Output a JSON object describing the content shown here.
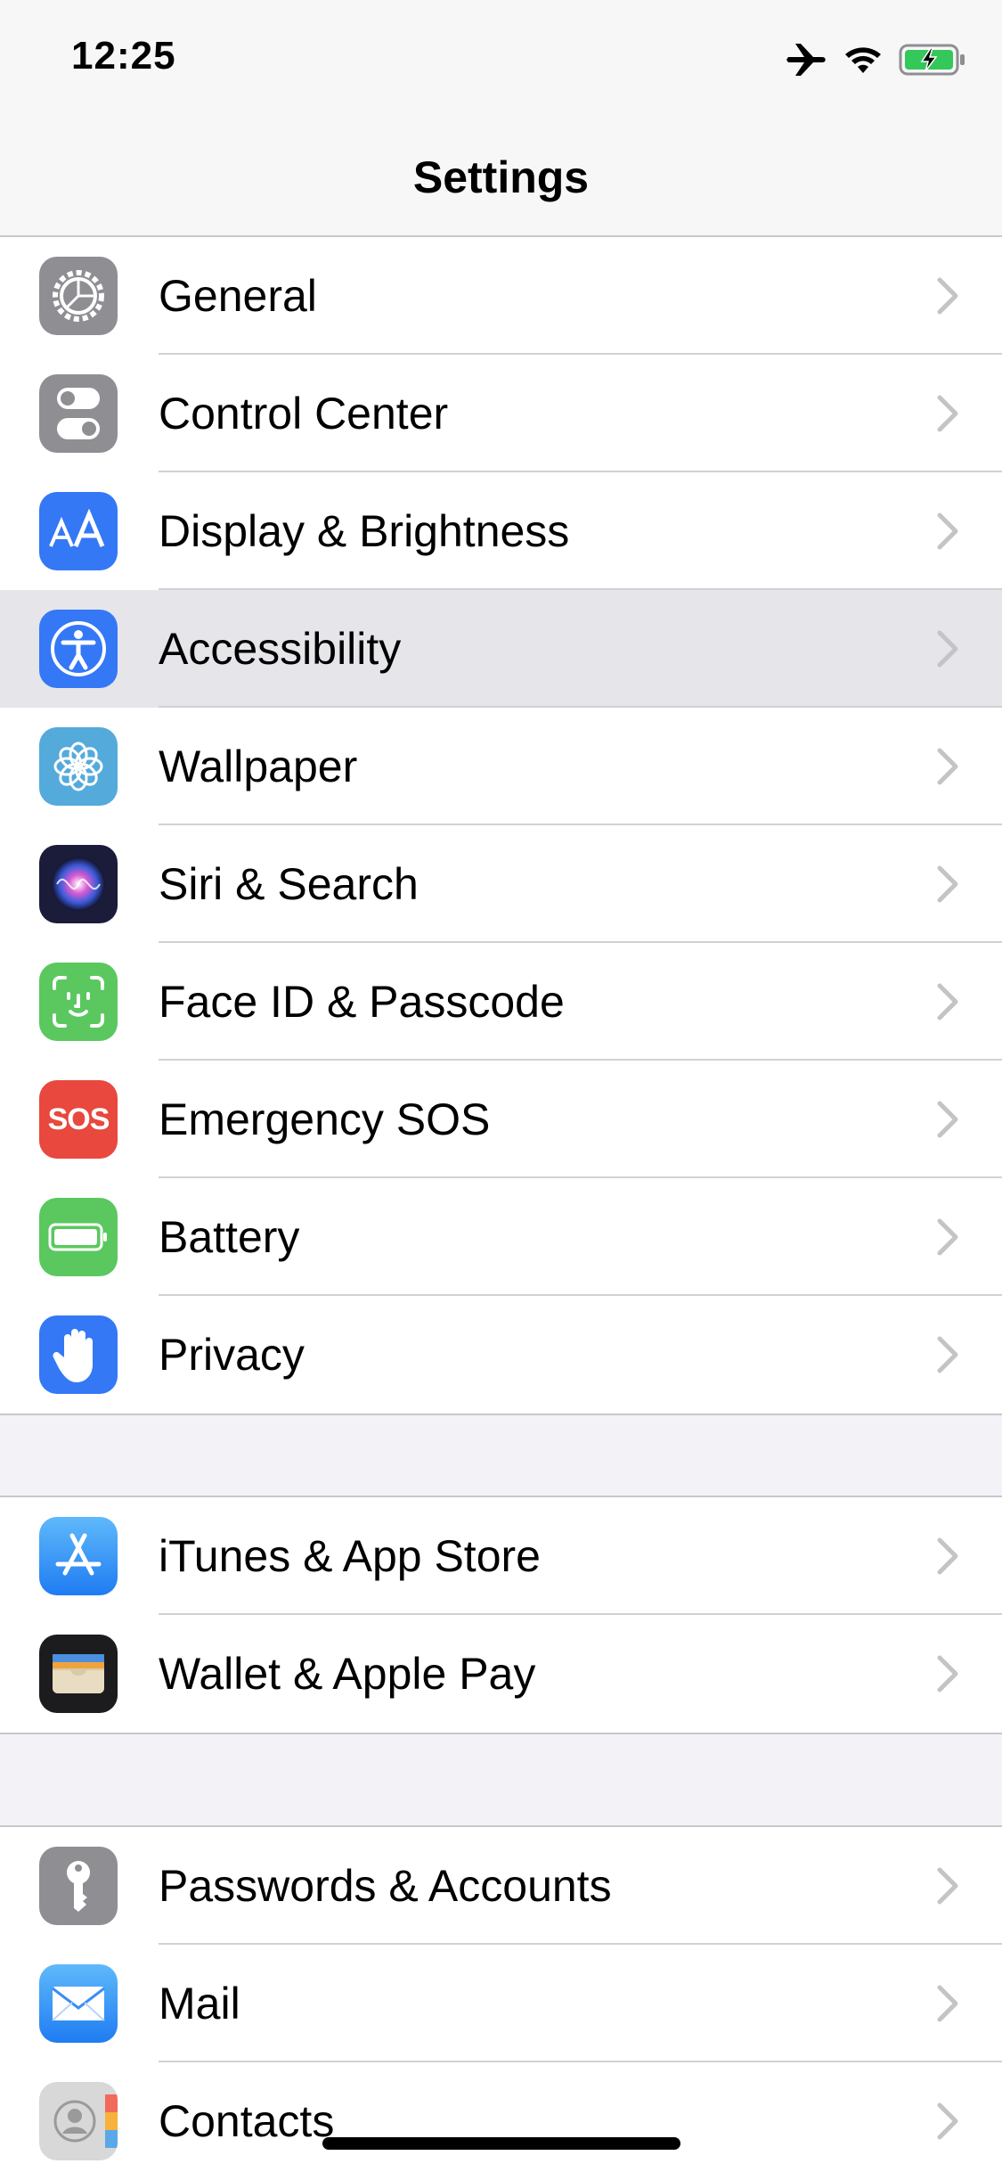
{
  "status": {
    "time": "12:25"
  },
  "nav": {
    "title": "Settings"
  },
  "colors": {
    "background": "#f2f2f7",
    "highlight": "#e5e5ea",
    "chevron": "#c4c4c7"
  },
  "groups": [
    {
      "items": [
        {
          "label": "General",
          "icon": "gear-icon",
          "color": "#8e8e93"
        },
        {
          "label": "Control Center",
          "icon": "toggles-icon",
          "color": "#8e8e93"
        },
        {
          "label": "Display & Brightness",
          "icon": "text-size-icon",
          "color": "#3478f6"
        },
        {
          "label": "Accessibility",
          "icon": "accessibility-icon",
          "color": "#3478f6",
          "highlighted": true
        },
        {
          "label": "Wallpaper",
          "icon": "flower-icon",
          "color": "#54aadb"
        },
        {
          "label": "Siri & Search",
          "icon": "siri-icon",
          "color": "#1b1b3a"
        },
        {
          "label": "Face ID & Passcode",
          "icon": "face-id-icon",
          "color": "#5ac85f"
        },
        {
          "label": "Emergency SOS",
          "icon": "sos-icon",
          "color": "#e8483d"
        },
        {
          "label": "Battery",
          "icon": "battery-icon",
          "color": "#5ac85f"
        },
        {
          "label": "Privacy",
          "icon": "hand-icon",
          "color": "#3478f6"
        }
      ]
    },
    {
      "items": [
        {
          "label": "iTunes & App Store",
          "icon": "app-store-icon",
          "color": "#3e9cf6"
        },
        {
          "label": "Wallet & Apple Pay",
          "icon": "wallet-icon",
          "color": "#1c1c1e"
        }
      ]
    },
    {
      "items": [
        {
          "label": "Passwords & Accounts",
          "icon": "key-icon",
          "color": "#8e8e93"
        },
        {
          "label": "Mail",
          "icon": "mail-icon",
          "color": "#3a8df5"
        },
        {
          "label": "Contacts",
          "icon": "contacts-icon",
          "color": "#cfcfcf"
        }
      ]
    }
  ]
}
